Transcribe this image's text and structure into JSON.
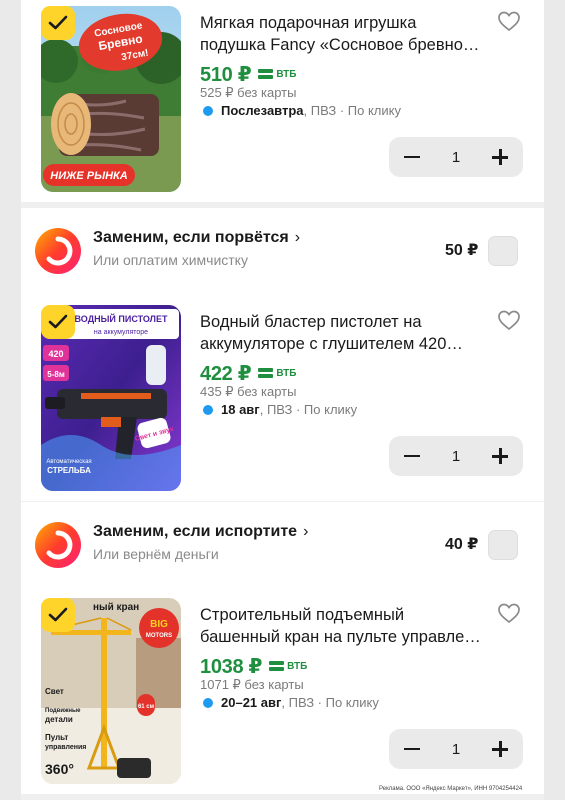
{
  "products": [
    {
      "title_line1": "Мягкая подарочная игрушка",
      "title_line2": "подушка Fancy «Сосновое бревно…",
      "price": "510 ₽",
      "bank_label": "ВТБ",
      "old_price": "525 ₽ без карты",
      "delivery_day": "Послезавтра",
      "delivery_rest": ", ПВЗ · По клику",
      "quantity": "1",
      "image": {
        "badge": "НИЖЕ РЫНКА",
        "sticker_line1": "Сосновое",
        "sticker_line2": "Бревно",
        "sticker_line3": "37см!"
      }
    },
    {
      "title_line1": "Водный бластер пистолет на",
      "title_line2": "аккумуляторе с глушителем 420…",
      "price": "422 ₽",
      "bank_label": "ВТБ",
      "old_price": "435 ₽ без карты",
      "delivery_day": "18 авг",
      "delivery_rest": ", ПВЗ · По клику",
      "quantity": "1",
      "image": {
        "header_line1": "ВОДНЫЙ ПИСТОЛЕТ",
        "header_line2": "на аккумуляторе",
        "stat1": "420",
        "stat2": "5-8м",
        "sticker": "Свет и звук",
        "footer_line1": "Автоматическая",
        "footer_line2": "СТРЕЛЬБА"
      }
    },
    {
      "title_line1": "Строительный подъемный",
      "title_line2": "башенный кран на пульте управле…",
      "price": "1038 ₽",
      "bank_label": "ВТБ",
      "old_price": "1071 ₽ без карты",
      "delivery_day": "20–21 авг",
      "delivery_rest": ", ПВЗ · По клику",
      "quantity": "1",
      "image": {
        "header": "ный кран",
        "brand_line1": "BIG",
        "brand_line2": "MOTORS",
        "height_label": "61 см",
        "feature1": "Свет",
        "feature2_line1": "Подвижные",
        "feature2_line2": "детали",
        "feature3_line1": "Пульт",
        "feature3_line2": "управления",
        "rotation": "360°"
      }
    }
  ],
  "services": [
    {
      "title": "Заменим, если порвётся",
      "chevron": "›",
      "subtitle": "Или оплатим химчистку",
      "price": "50 ₽"
    },
    {
      "title": "Заменим, если испортите",
      "chevron": "›",
      "subtitle": "Или вернём деньги",
      "price": "40 ₽"
    }
  ],
  "footer_note": "Реклама. ООО «Яндекс Маркет», ИНН 9704254424",
  "colors": {
    "price_green": "#1f8f3f",
    "check_yellow": "#fed42b",
    "delivery_dot": "#1e9bf0"
  }
}
